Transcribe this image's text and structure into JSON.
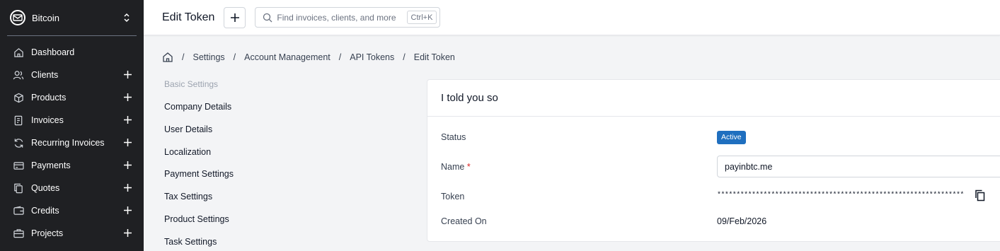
{
  "sidebar": {
    "company_name": "Bitcoin",
    "items": [
      {
        "label": "Dashboard",
        "icon": "home-icon",
        "has_add": false
      },
      {
        "label": "Clients",
        "icon": "users-icon",
        "has_add": true
      },
      {
        "label": "Products",
        "icon": "box-icon",
        "has_add": true
      },
      {
        "label": "Invoices",
        "icon": "file-icon",
        "has_add": true
      },
      {
        "label": "Recurring Invoices",
        "icon": "refresh-icon",
        "has_add": true
      },
      {
        "label": "Payments",
        "icon": "credit-card-icon",
        "has_add": true
      },
      {
        "label": "Quotes",
        "icon": "copy-doc-icon",
        "has_add": true
      },
      {
        "label": "Credits",
        "icon": "wallet-icon",
        "has_add": true
      },
      {
        "label": "Projects",
        "icon": "briefcase-icon",
        "has_add": true
      }
    ]
  },
  "topbar": {
    "title": "Edit Token",
    "search_placeholder": "Find invoices, clients, and more",
    "shortcut": "Ctrl+K"
  },
  "breadcrumb": {
    "separator": "/",
    "items": [
      "Settings",
      "Account Management",
      "API Tokens",
      "Edit Token"
    ]
  },
  "settings_nav": {
    "heading": "Basic Settings",
    "items": [
      "Company Details",
      "User Details",
      "Localization",
      "Payment Settings",
      "Tax Settings",
      "Product Settings",
      "Task Settings"
    ]
  },
  "token_card": {
    "title": "I told you so",
    "status_label": "Status",
    "status_value": "Active",
    "name_label": "Name",
    "required_mark": "*",
    "name_value": "payinbtc.me",
    "token_label": "Token",
    "token_value": "****************************************************************",
    "created_label": "Created On",
    "created_value": "09/Feb/2026"
  },
  "colors": {
    "sidebar_bg": "#1f2023",
    "badge_bg": "#1f6fbf",
    "required": "#dc2626"
  }
}
